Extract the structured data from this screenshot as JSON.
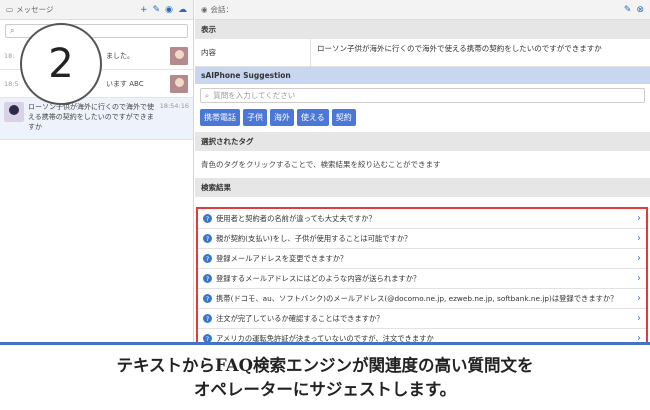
{
  "left_panel": {
    "title": "メッセージ",
    "tool_icons": [
      "plus-icon",
      "edit-icon",
      "eye-icon",
      "cloud-icon"
    ],
    "search_icon": "search-icon",
    "conversations": [
      {
        "time": "18:",
        "text": "ました。"
      },
      {
        "time": "18:5",
        "text": "います ABC"
      },
      {
        "time": "18:54:16",
        "text": "ローソン子供が海外に行くので海外で使える携帯の契約をしたいのですができますか"
      }
    ]
  },
  "step": {
    "number": "2"
  },
  "right_panel": {
    "title": "会話：",
    "display_section": {
      "header": "表示",
      "key": "内容",
      "value": "ローソン子供が海外に行くので海外で使える携帯の契約をしたいのですができますか"
    },
    "suggestion": {
      "header": "sAIPhone Suggestion",
      "search_placeholder": "質問を入力してください",
      "tags": [
        "携帯電話",
        "子供",
        "海外",
        "使える",
        "契約"
      ]
    },
    "selected_tags": {
      "header": "選択されたタグ",
      "hint": "青色のタグをクリックすることで、検索結果を絞り込むことができます"
    },
    "results": {
      "header": "検索結果",
      "items": [
        "使用者と契約者の名前が違っても大丈夫ですか？",
        "親が契約(支払い)をし、子供が使用することは可能ですか？",
        "登録メールアドレスを変更できますか？",
        "登録するメールアドレスにはどのような内容が送られますか？",
        "携帯(ドコモ、au、ソフトバンク)のメールアドレス(@docomo.ne.jp, ezweb.ne.jp, softbank.ne.jp)は登録できますか？",
        "注文が完了しているか確認することはできますか？",
        "アメリカの運転免許証が決まっていないのですが、注文できますか"
      ]
    }
  },
  "caption": {
    "line1": "テキストからFAQ検索エンジンが関連度の高い質問文を",
    "line2": "オペレーターにサジェストします。"
  },
  "colors": {
    "accent": "#4b77d6",
    "highlight_border": "#e23b3b",
    "caption_border": "#4472c4"
  }
}
